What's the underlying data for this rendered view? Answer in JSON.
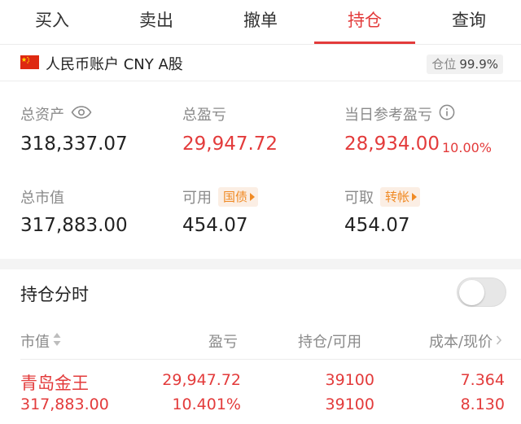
{
  "tabs": [
    {
      "label": "买入",
      "active": false
    },
    {
      "label": "卖出",
      "active": false
    },
    {
      "label": "撤单",
      "active": false
    },
    {
      "label": "持仓",
      "active": true
    },
    {
      "label": "查询",
      "active": false
    }
  ],
  "account": {
    "label": "人民币账户 CNY A股",
    "position_label": "仓位",
    "position_value": "99.9%"
  },
  "stats": {
    "total_assets": {
      "label": "总资产",
      "value": "318,337.07"
    },
    "total_pnl": {
      "label": "总盈亏",
      "value": "29,947.72"
    },
    "day_pnl": {
      "label": "当日参考盈亏",
      "value": "28,934.00",
      "pct": "10.00%"
    },
    "market_value": {
      "label": "总市值",
      "value": "317,883.00"
    },
    "available": {
      "label": "可用",
      "value": "454.07",
      "tag": "国债"
    },
    "withdrawable": {
      "label": "可取",
      "value": "454.07",
      "tag": "转帐"
    }
  },
  "holdings": {
    "title": "持仓分时",
    "toggle_on": false,
    "columns": [
      "市值",
      "盈亏",
      "持仓/可用",
      "成本/现价"
    ],
    "rows": [
      {
        "name": "青岛金王",
        "market_value": "317,883.00",
        "pnl": "29,947.72",
        "pnl_pct": "10.401%",
        "position": "39100",
        "available": "39100",
        "cost": "7.364",
        "price": "8.130"
      }
    ]
  },
  "colors": {
    "accent": "#e33b3b",
    "tag_text": "#f08a24",
    "tag_bg": "#fbeee4",
    "muted": "#8a8a8a"
  }
}
